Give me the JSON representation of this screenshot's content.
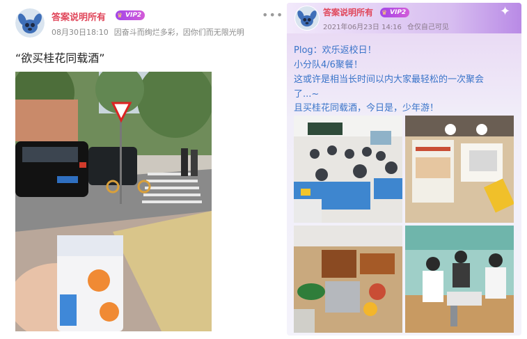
{
  "left_post": {
    "username": "答案说明所有",
    "vip_label": "VIP2",
    "date": "08月30日18:10",
    "signature": "因奋斗而绚烂多彩，因你们而无限光明",
    "more_icon": "more-dots-icon",
    "content": "“欲买桂花同载酒”",
    "photo": "street-snack-photo"
  },
  "right_post": {
    "username": "答案说明所有",
    "vip_label": "VIP2",
    "date": "2021年06月23日 14:16",
    "visibility": "仓仅自己可见",
    "lines": [
      "Plog：欢乐返校日！",
      "小分队4/6聚餐！",
      "这或许是相当长时间以内大家最轻松的一次聚会",
      "了...~",
      "且买桂花同载酒，今日是，少年游！"
    ],
    "photos": [
      "classroom-photo",
      "restaurant-table-photo",
      "bbq-food-photo",
      "friends-dinner-photo"
    ]
  },
  "colors": {
    "username": "#e0465a",
    "body_text_right": "#3a74c9",
    "meta": "#8a8a8a"
  }
}
